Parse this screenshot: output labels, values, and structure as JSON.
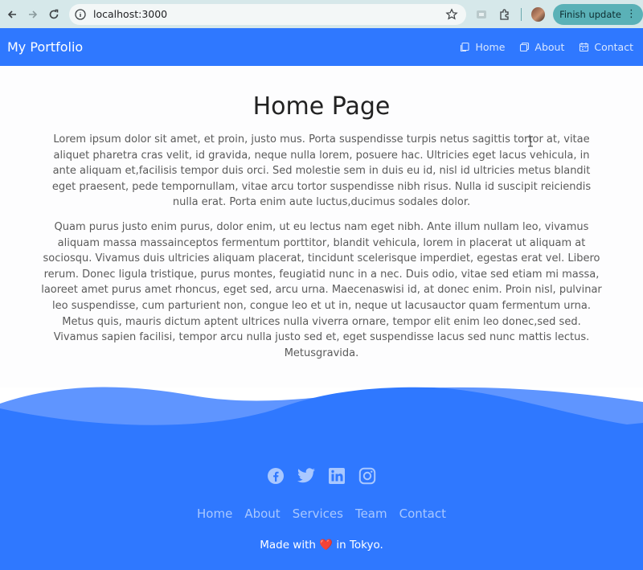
{
  "browser": {
    "url": "localhost:3000",
    "update_label": "Finish update"
  },
  "header": {
    "brand": "My Portfolio",
    "nav": [
      {
        "label": "Home",
        "icon": "page-icon"
      },
      {
        "label": "About",
        "icon": "copy-icon"
      },
      {
        "label": "Contact",
        "icon": "calendar-icon"
      }
    ]
  },
  "main": {
    "title": "Home Page",
    "paragraphs": [
      "Lorem ipsum dolor sit amet, et proin, justo mus. Porta suspendisse turpis netus sagittis tortor at, vitae aliquet pharetra cras velit, id gravida, neque nulla lorem, posuere hac. Ultricies eget lacus vehicula, in ante aliquam et,facilisis tempor duis orci. Sed molestie sem in duis eu id, nisl id ultricies metus blandit eget praesent, pede tempornullam, vitae arcu tortor suspendisse nibh risus. Nulla id suscipit reiciendis nulla erat. Porta enim aute luctus,ducimus sodales dolor.",
      "Quam purus justo enim purus, dolor enim, ut eu lectus nam eget nibh. Ante illum nullam leo, vivamus aliquam massa massainceptos fermentum porttitor, blandit vehicula, lorem in placerat ut aliquam at sociosqu. Vivamus duis ultricies aliquam placerat, tincidunt scelerisque imperdiet, egestas erat vel. Libero rerum. Donec ligula tristique, purus montes, feugiatid nunc in a nec. Duis odio, vitae sed etiam mi massa, laoreet amet purus amet rhoncus, eget sed, arcu urna. Maecenaswisi id, at donec enim. Proin nisl, pulvinar leo suspendisse, cum parturient non, congue leo et ut in, neque ut lacusauctor quam fermentum urna. Metus quis, mauris dictum aptent ultrices nulla viverra ornare, tempor elit enim leo donec,sed sed. Vivamus sapien facilisi, tempor arcu nulla justo sed et, eget suspendisse lacus sed nunc mattis lectus. Metusgravida."
    ]
  },
  "footer": {
    "socials": [
      "facebook-icon",
      "twitter-icon",
      "linkedin-icon",
      "instagram-icon"
    ],
    "links": [
      "Home",
      "About",
      "Services",
      "Team",
      "Contact"
    ],
    "made_prefix": "Made with",
    "heart": "❤️",
    "made_suffix": "in Tokyo."
  },
  "colors": {
    "primary": "#2f78ff",
    "wave_light": "#5f95ff",
    "chrome": "#d6e8ea",
    "update_button": "#5ab1b7"
  }
}
